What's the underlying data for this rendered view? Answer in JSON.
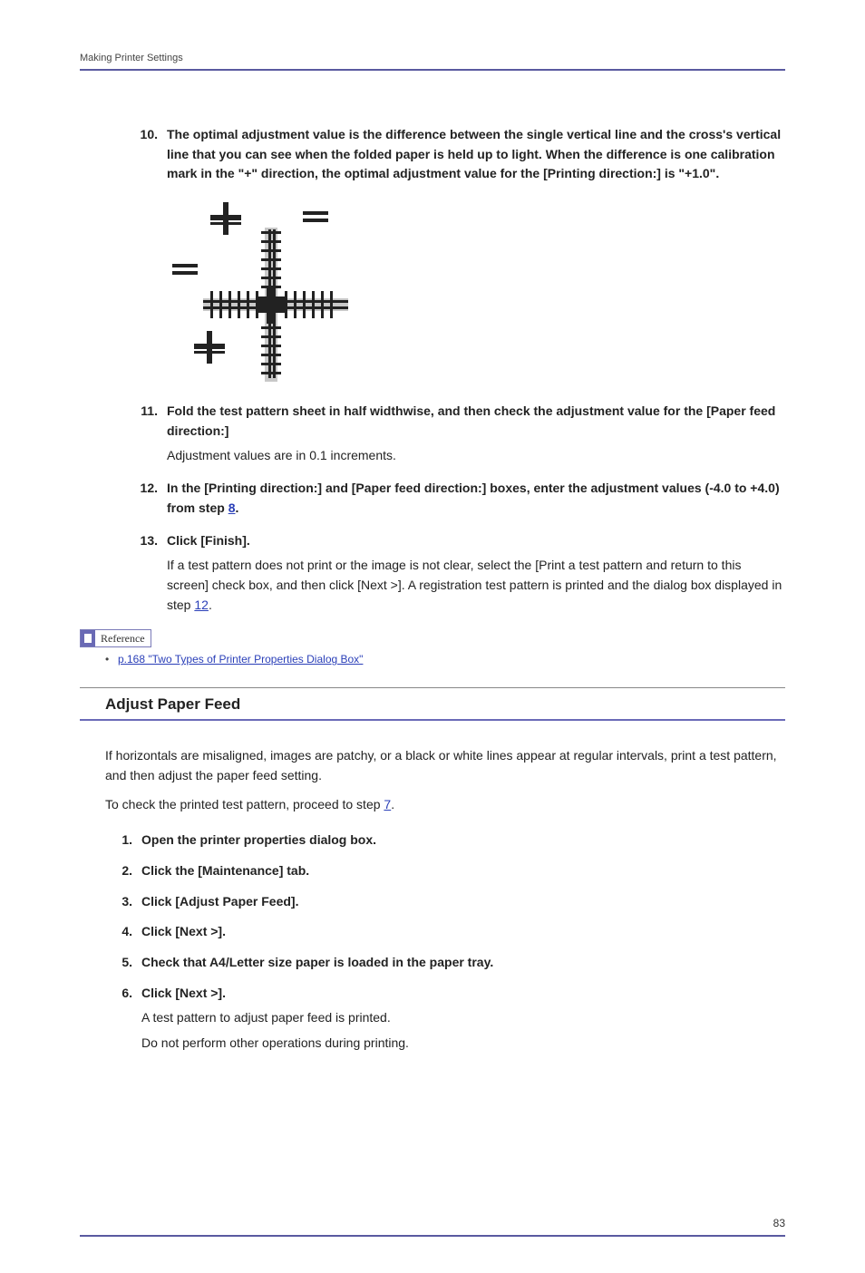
{
  "header": {
    "running": "Making Printer Settings"
  },
  "steps": [
    {
      "bold": "The optimal adjustment value is the difference between the single vertical line and the cross's vertical line that you can see when the folded paper is held up to light. When the difference is one calibration mark in the \"+\" direction, the optimal adjustment value for the [Printing direction:] is \"+1.0\"."
    },
    {
      "bold": "Fold the test pattern sheet in half widthwise, and then check the adjustment value for the [Paper feed direction:]",
      "body": "Adjustment values are in 0.1 increments."
    },
    {
      "bold_pre": "In the [Printing direction:] and [Paper feed direction:] boxes, enter the adjustment values (-4.0 to +4.0) from step ",
      "link_text": "8",
      "bold_post": "."
    },
    {
      "bold": "Click [Finish].",
      "body_pre": "If a test pattern does not print or the image is not clear, select the [Print a test pattern and return to this screen] check box, and then click [Next >]. A registration test pattern is printed and the dialog box displayed in step ",
      "body_link": "12",
      "body_post": "."
    }
  ],
  "reference": {
    "label": "Reference",
    "link": "p.168 \"Two Types of Printer Properties Dialog Box\""
  },
  "section": {
    "title": "Adjust Paper Feed",
    "p1": "If horizontals are misaligned, images are patchy, or a black or white lines appear at regular intervals, print a test pattern, and then adjust the paper feed setting.",
    "p2_pre": "To check the printed test pattern, proceed to step ",
    "p2_link": "7",
    "p2_post": ".",
    "steps": [
      {
        "bold": "Open the printer properties dialog box."
      },
      {
        "bold": "Click the [Maintenance] tab."
      },
      {
        "bold": "Click [Adjust Paper Feed]."
      },
      {
        "bold": "Click [Next >]."
      },
      {
        "bold": "Check that A4/Letter size paper is loaded in the paper tray."
      },
      {
        "bold": "Click [Next >].",
        "body1": "A test pattern to adjust paper feed is printed.",
        "body2": "Do not perform other operations during printing."
      }
    ]
  },
  "footer": {
    "page": "83"
  }
}
